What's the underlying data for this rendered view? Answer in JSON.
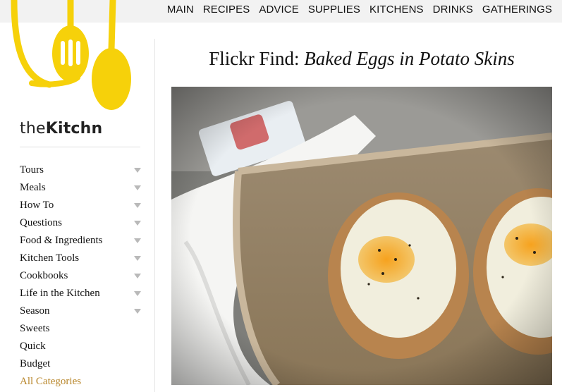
{
  "nav": {
    "items": [
      "MAIN",
      "RECIPES",
      "ADVICE",
      "SUPPLIES",
      "KITCHENS",
      "DRINKS",
      "GATHERINGS"
    ]
  },
  "brand": {
    "part1": "the",
    "part2": "Kitchn"
  },
  "sidebar": {
    "items": [
      {
        "label": "Tours"
      },
      {
        "label": "Meals"
      },
      {
        "label": "How To"
      },
      {
        "label": "Questions"
      },
      {
        "label": "Food & Ingredients"
      },
      {
        "label": "Kitchen Tools"
      },
      {
        "label": "Cookbooks"
      },
      {
        "label": "Life in the Kitchen"
      },
      {
        "label": "Season"
      },
      {
        "label": "Sweets"
      },
      {
        "label": "Quick"
      },
      {
        "label": "Budget"
      },
      {
        "label": "All Categories"
      }
    ]
  },
  "article": {
    "title_prefix": "Flickr Find: ",
    "title_italic": "Baked Eggs in Potato Skins"
  },
  "colors": {
    "brand_yellow": "#f6d10a",
    "accent": "#b8862a",
    "nav_bg": "#f2f2f2"
  }
}
